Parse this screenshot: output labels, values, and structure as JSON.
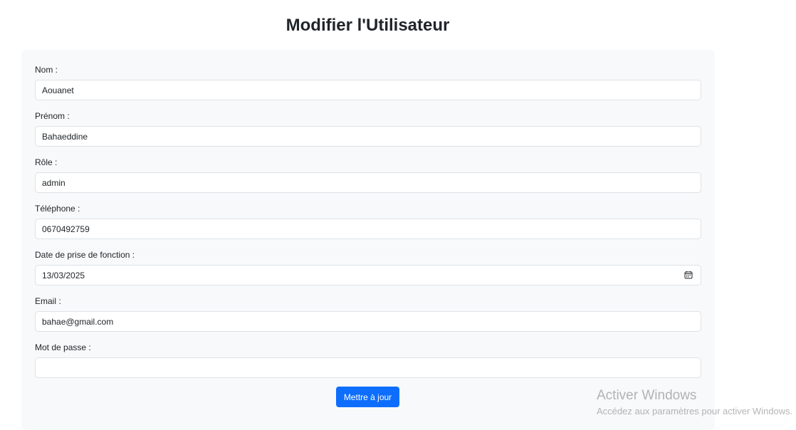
{
  "page": {
    "title": "Modifier l'Utilisateur"
  },
  "form": {
    "nom": {
      "label": "Nom :",
      "value": "Aouanet"
    },
    "prenom": {
      "label": "Prénom :",
      "value": "Bahaeddine"
    },
    "role": {
      "label": "Rôle :",
      "value": "admin"
    },
    "telephone": {
      "label": "Téléphone :",
      "value": "0670492759"
    },
    "date_prise_fonction": {
      "label": "Date de prise de fonction :",
      "value": "13/03/2025",
      "icon": "calendar-icon"
    },
    "email": {
      "label": "Email :",
      "value": "bahae@gmail.com"
    },
    "mot_de_passe": {
      "label": "Mot de passe :",
      "value": ""
    },
    "submit_label": "Mettre à jour",
    "submit_color": "#0d6efd"
  },
  "watermark": {
    "title": "Activer Windows",
    "subtitle": "Accédez aux paramètres pour activer Windows."
  }
}
